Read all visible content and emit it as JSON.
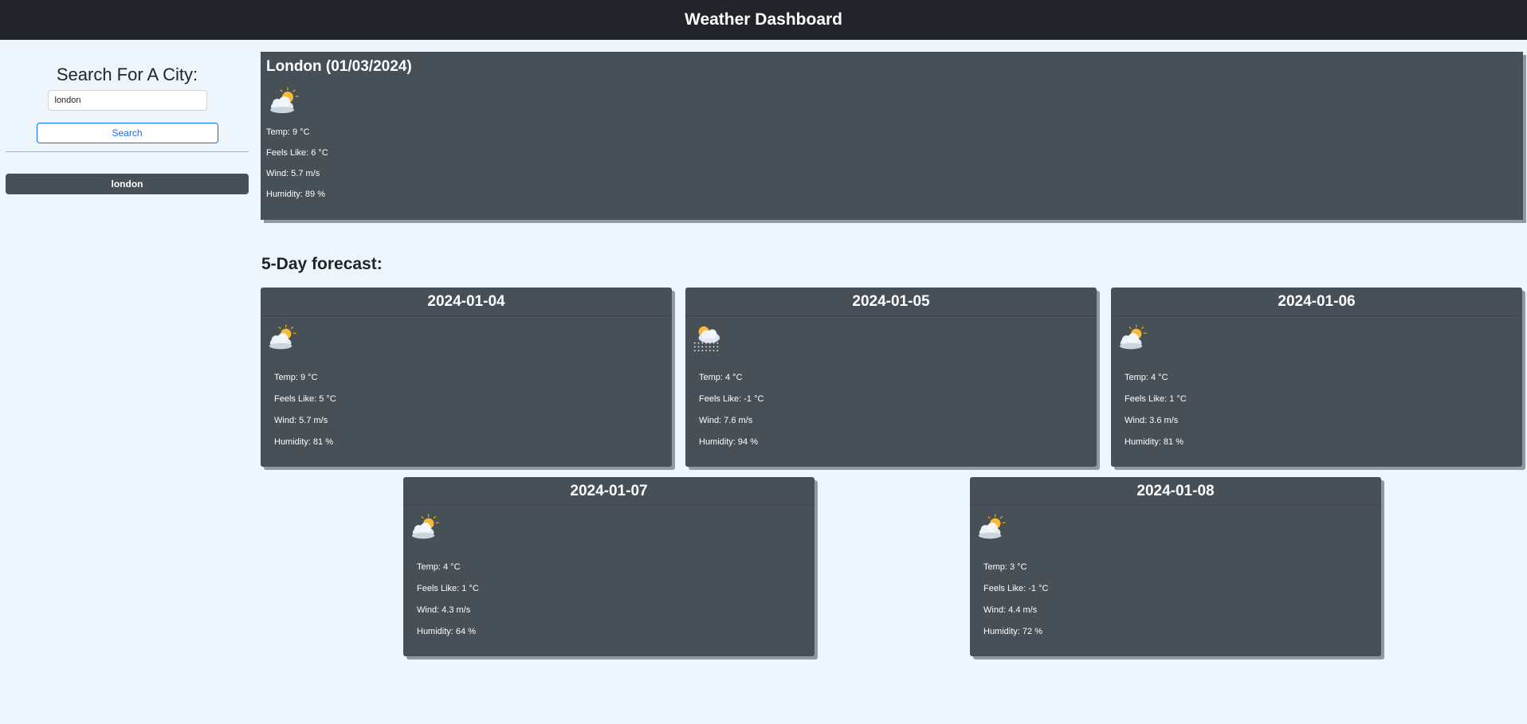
{
  "header": {
    "title": "Weather Dashboard"
  },
  "sidebar": {
    "search_title": "Search For A City:",
    "search_value": "london",
    "search_button": "Search",
    "history": [
      {
        "label": "london"
      }
    ]
  },
  "current": {
    "title": "London (01/03/2024)",
    "icon": "partly-cloudy-icon",
    "temp": "Temp: 9 °C",
    "feels": "Feels Like: 6 °C",
    "wind": "Wind: 5.7 m/s",
    "humidity": "Humidity: 89 %"
  },
  "forecast": {
    "title": "5-Day forecast:",
    "days": [
      {
        "date": "2024-01-04",
        "icon": "partly-cloudy-icon",
        "temp": "Temp: 9 °C",
        "feels": "Feels Like: 5 °C",
        "wind": "Wind: 5.7 m/s",
        "humidity": "Humidity: 81 %"
      },
      {
        "date": "2024-01-05",
        "icon": "snow-cloud-icon",
        "temp": "Temp: 4 °C",
        "feels": "Feels Like: -1 °C",
        "wind": "Wind: 7.6 m/s",
        "humidity": "Humidity: 94 %"
      },
      {
        "date": "2024-01-06",
        "icon": "partly-cloudy-icon",
        "temp": "Temp: 4 °C",
        "feels": "Feels Like: 1 °C",
        "wind": "Wind: 3.6 m/s",
        "humidity": "Humidity: 81 %"
      },
      {
        "date": "2024-01-07",
        "icon": "partly-cloudy-icon",
        "temp": "Temp: 4 °C",
        "feels": "Feels Like: 1 °C",
        "wind": "Wind: 4.3 m/s",
        "humidity": "Humidity: 64 %"
      },
      {
        "date": "2024-01-08",
        "icon": "partly-cloudy-icon",
        "temp": "Temp: 3 °C",
        "feels": "Feels Like: -1 °C",
        "wind": "Wind: 4.4 m/s",
        "humidity": "Humidity: 72 %"
      }
    ]
  },
  "colors": {
    "header_bg": "#212529",
    "card_bg": "#474f57",
    "page_bg": "#eef6fd",
    "accent": "#0d6efd"
  }
}
